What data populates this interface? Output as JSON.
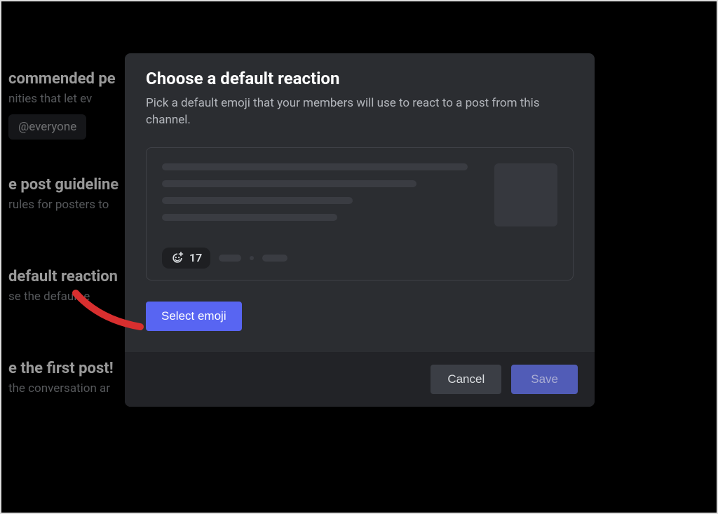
{
  "background": {
    "permissions_heading": "commended pe",
    "permissions_text": "nities that let ev",
    "everyone_tag": "@everyone",
    "guidelines_heading": "e post guideline",
    "guidelines_text": "rules for posters to",
    "reaction_heading": "default reaction",
    "reaction_text": "se the default e",
    "firstpost_heading": "e the first post!",
    "firstpost_text": "the conversation ar"
  },
  "modal": {
    "title": "Choose a default reaction",
    "description": "Pick a default emoji that your members will use to react to a post from this channel.",
    "reaction_count": "17",
    "select_emoji_label": "Select emoji",
    "cancel_label": "Cancel",
    "save_label": "Save"
  }
}
